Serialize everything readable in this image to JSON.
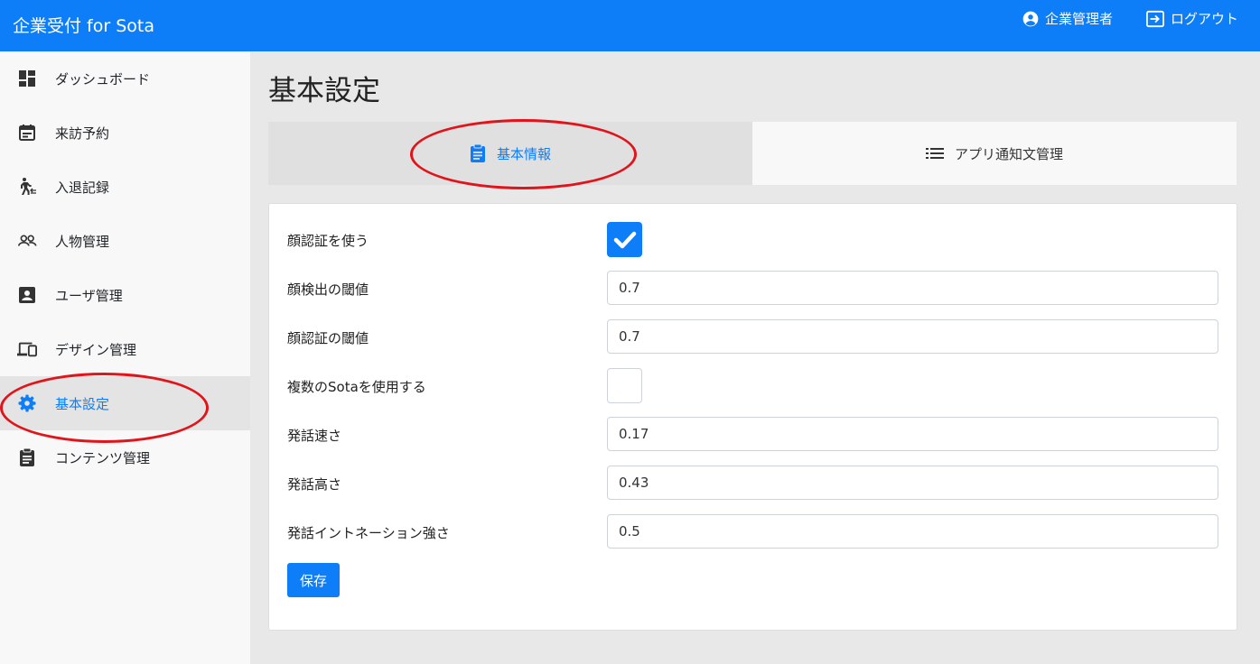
{
  "header": {
    "app_title": "企業受付 for Sota",
    "user_label": "企業管理者",
    "logout_label": "ログアウト"
  },
  "sidebar": {
    "items": [
      {
        "label": "ダッシュボード",
        "icon": "dashboard-icon"
      },
      {
        "label": "来訪予約",
        "icon": "calendar-icon"
      },
      {
        "label": "入退記録",
        "icon": "walking-person-icon"
      },
      {
        "label": "人物管理",
        "icon": "people-icon"
      },
      {
        "label": "ユーザ管理",
        "icon": "contact-card-icon"
      },
      {
        "label": "デザイン管理",
        "icon": "devices-icon"
      },
      {
        "label": "基本設定",
        "icon": "gear-icon",
        "active": true
      },
      {
        "label": "コンテンツ管理",
        "icon": "clipboard-icon"
      }
    ]
  },
  "main": {
    "title": "基本設定",
    "tabs": [
      {
        "label": "基本情報",
        "icon": "clipboard-icon",
        "active": true
      },
      {
        "label": "アプリ通知文管理",
        "icon": "list-icon"
      }
    ],
    "form": {
      "face_auth_label": "顔認証を使う",
      "face_auth_checked": true,
      "face_detect_threshold_label": "顔検出の閾値",
      "face_detect_threshold_value": "0.7",
      "face_auth_threshold_label": "顔認証の閾値",
      "face_auth_threshold_value": "0.7",
      "multi_sota_label": "複数のSotaを使用する",
      "multi_sota_checked": false,
      "speech_speed_label": "発話速さ",
      "speech_speed_value": "0.17",
      "speech_pitch_label": "発話高さ",
      "speech_pitch_value": "0.43",
      "speech_intonation_label": "発話イントネーション強さ",
      "speech_intonation_value": "0.5",
      "save_label": "保存"
    }
  },
  "colors": {
    "accent": "#0d7ef8",
    "annotation": "#e0141a"
  }
}
